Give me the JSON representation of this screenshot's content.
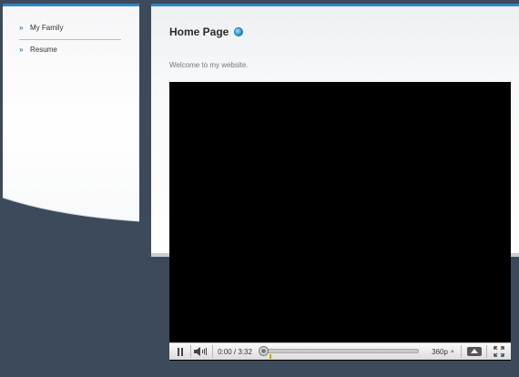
{
  "sidebar": {
    "items": [
      {
        "label": "My Family",
        "bullet": "»"
      },
      {
        "label": "Resume",
        "bullet": "»"
      }
    ]
  },
  "main": {
    "title": "Home Page",
    "welcome": "Welcome to my website."
  },
  "player": {
    "time": "0:00 / 3:32",
    "quality": "360p",
    "progress_fraction": 0.0
  },
  "colors": {
    "accent": "#2f86c3",
    "background": "#3c4a5b"
  }
}
